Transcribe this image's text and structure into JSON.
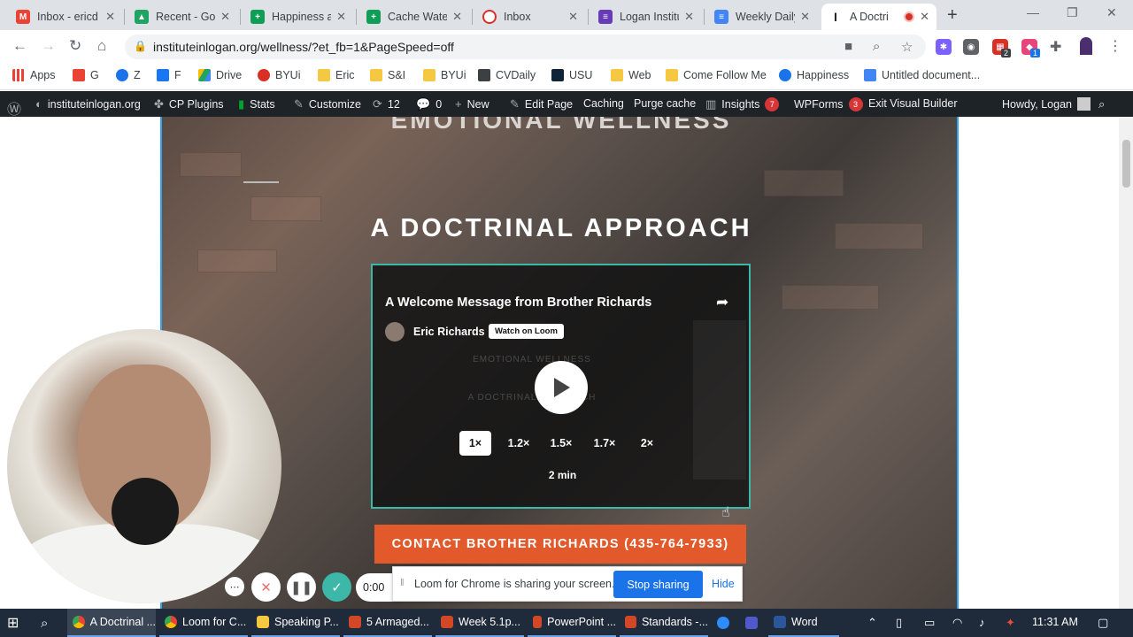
{
  "tabs": [
    {
      "title": "Inbox - ericd",
      "icon": "gmail-icon",
      "color": "#ea4335"
    },
    {
      "title": "Recent - Goo",
      "icon": "google-drive-icon",
      "color": "#1fa463"
    },
    {
      "title": "Happiness ar",
      "icon": "google-sheets-icon",
      "color": "#0f9d58"
    },
    {
      "title": "Cache Water",
      "icon": "google-sheets-icon",
      "color": "#0f9d58"
    },
    {
      "title": "Inbox",
      "icon": "inbox-icon",
      "color": "#d93025"
    },
    {
      "title": "Logan Institu",
      "icon": "google-forms-icon",
      "color": "#673ab7"
    },
    {
      "title": "Weekly Daily",
      "icon": "google-docs-icon",
      "color": "#4285f4"
    },
    {
      "title": "A Doctri",
      "icon": "institute-icon",
      "color": "#202124"
    }
  ],
  "address": {
    "url": "instituteinlogan.org/wellness/?et_fb=1&PageSpeed=off"
  },
  "extensions": [
    {
      "icon": "extension-star-icon",
      "color": "#7b61ff",
      "badge": ""
    },
    {
      "icon": "extension-chat-icon",
      "color": "#5f6368",
      "badge": ""
    },
    {
      "icon": "extension-red-icon",
      "color": "#d93025",
      "badge": "2"
    },
    {
      "icon": "extension-pink-icon",
      "color": "#e8457a",
      "badge": "1"
    }
  ],
  "bookmarks": [
    {
      "label": "Apps",
      "icon": "apps-grid-icon",
      "color": "#ea4335"
    },
    {
      "label": "G",
      "icon": "gmail-icon",
      "color": "#ea4335"
    },
    {
      "label": "Z",
      "icon": "zoho-icon",
      "color": "#1a73e8"
    },
    {
      "label": "F",
      "icon": "facebook-icon",
      "color": "#1877f2"
    },
    {
      "label": "Drive",
      "icon": "google-drive-icon",
      "color": "#1fa463"
    },
    {
      "label": "BYUi",
      "icon": "byui-icon",
      "color": "#d93025"
    },
    {
      "label": "Eric",
      "icon": "folder-icon",
      "color": "#f5c842"
    },
    {
      "label": "S&I",
      "icon": "folder-icon",
      "color": "#f5c842"
    },
    {
      "label": "BYUi",
      "icon": "folder-icon",
      "color": "#f5c842"
    },
    {
      "label": "CVDaily",
      "icon": "cvdaily-icon",
      "color": "#3c4043"
    },
    {
      "label": "USU",
      "icon": "usu-icon",
      "color": "#0f2439"
    },
    {
      "label": "Web",
      "icon": "folder-icon",
      "color": "#f5c842"
    },
    {
      "label": "Come Follow Me",
      "icon": "folder-icon",
      "color": "#f5c842"
    },
    {
      "label": "Happiness",
      "icon": "link-icon",
      "color": "#1a73e8"
    },
    {
      "label": "Untitled document...",
      "icon": "google-docs-icon",
      "color": "#4285f4"
    }
  ],
  "wpbar": {
    "site": "instituteinlogan.org",
    "cp_plugins": "CP Plugins",
    "stats": "Stats",
    "customize": "Customize",
    "updates": "12",
    "comments": "0",
    "new": "New",
    "edit_page": "Edit Page",
    "caching": "Caching",
    "purge": "Purge cache",
    "insights": "Insights",
    "insights_badge": "7",
    "wpforms": "WPForms",
    "wpforms_badge": "3",
    "exit_vb": "Exit Visual Builder",
    "howdy": "Howdy, Logan"
  },
  "page": {
    "headline_top": "EMOTIONAL WELLNESS",
    "headline": "A DOCTRINAL APPROACH",
    "contact_button": "CONTACT BROTHER RICHARDS (435-764-7933)"
  },
  "loom": {
    "title": "A Welcome Message from Brother Richards",
    "author": "Eric Richards",
    "watch_label": "Watch on Loom",
    "ghost_text_1": "EMOTIONAL WELLNESS",
    "ghost_text_2": "A DOCTRINAL APPROACH",
    "speeds": [
      "1×",
      "1.2×",
      "1.5×",
      "1.7×",
      "2×"
    ],
    "selected_speed": "1×",
    "duration": "2 min"
  },
  "recorder": {
    "timer": "0:00"
  },
  "sharebar": {
    "message": "Loom for Chrome is sharing your screen.",
    "stop_label": "Stop sharing",
    "hide_label": "Hide"
  },
  "taskbar": {
    "apps": [
      {
        "label": "A Doctrinal ...",
        "icon": "chrome-icon",
        "color": "#e8453c"
      },
      {
        "label": "Loom for C...",
        "icon": "chrome-icon",
        "color": "#e8453c"
      },
      {
        "label": "Speaking P...",
        "icon": "folder-icon",
        "color": "#f5c842"
      },
      {
        "label": "5 Armaged...",
        "icon": "powerpoint-icon",
        "color": "#d24726"
      },
      {
        "label": "Week 5.1p...",
        "icon": "powerpoint-icon",
        "color": "#d24726"
      },
      {
        "label": "PowerPoint ...",
        "icon": "powerpoint-icon",
        "color": "#d24726"
      },
      {
        "label": "Standards -...",
        "icon": "powerpoint-icon",
        "color": "#d24726"
      },
      {
        "label": "",
        "icon": "zoom-icon",
        "color": "#2d8cff"
      },
      {
        "label": "",
        "icon": "teams-icon",
        "color": "#5059c9"
      },
      {
        "label": "Word",
        "icon": "word-icon",
        "color": "#2b579a"
      }
    ],
    "clock": "11:31 AM"
  }
}
